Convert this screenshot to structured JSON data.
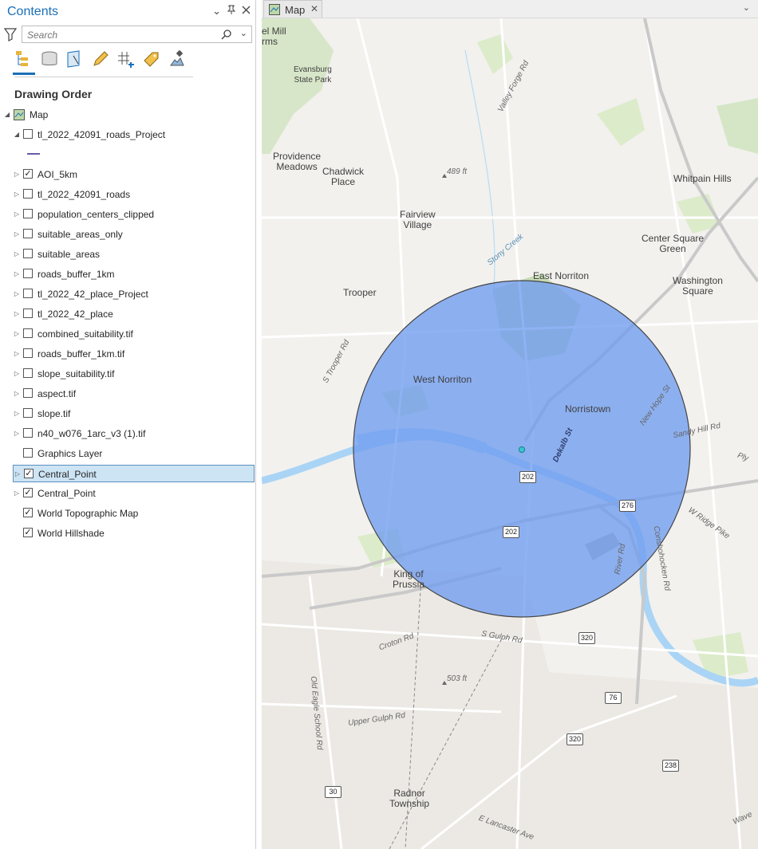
{
  "contents": {
    "title": "Contents",
    "search_placeholder": "Search",
    "section_title": "Drawing Order",
    "map_label": "Map",
    "layers": [
      {
        "name": "tl_2022_42091_roads_Project",
        "checked": false,
        "expanded": true
      },
      {
        "name": "AOI_5km",
        "checked": true,
        "expanded": false
      },
      {
        "name": "tl_2022_42091_roads",
        "checked": false,
        "expanded": false
      },
      {
        "name": "population_centers_clipped",
        "checked": false,
        "expanded": false
      },
      {
        "name": "suitable_areas_only",
        "checked": false,
        "expanded": false
      },
      {
        "name": "suitable_areas",
        "checked": false,
        "expanded": false
      },
      {
        "name": "roads_buffer_1km",
        "checked": false,
        "expanded": false
      },
      {
        "name": "tl_2022_42_place_Project",
        "checked": false,
        "expanded": false
      },
      {
        "name": "tl_2022_42_place",
        "checked": false,
        "expanded": false
      },
      {
        "name": "combined_suitability.tif",
        "checked": false,
        "expanded": false
      },
      {
        "name": "roads_buffer_1km.tif",
        "checked": false,
        "expanded": false
      },
      {
        "name": "slope_suitability.tif",
        "checked": false,
        "expanded": false
      },
      {
        "name": "aspect.tif",
        "checked": false,
        "expanded": false
      },
      {
        "name": "slope.tif",
        "checked": false,
        "expanded": false
      },
      {
        "name": "n40_w076_1arc_v3 (1).tif",
        "checked": false,
        "expanded": false
      },
      {
        "name": "Graphics Layer",
        "checked": false,
        "expanded": null
      },
      {
        "name": "Central_Point",
        "checked": true,
        "expanded": false,
        "selected": true
      },
      {
        "name": "Central_Point",
        "checked": true,
        "expanded": false
      },
      {
        "name": "World Topographic Map",
        "checked": true,
        "expanded": null
      },
      {
        "name": "World Hillshade",
        "checked": true,
        "expanded": null
      }
    ]
  },
  "map_tab": {
    "label": "Map"
  },
  "map": {
    "places": {
      "mill": "el Mill\nrms",
      "evansburg": "Evansburg\nState Park",
      "providence": "Providence\nMeadows",
      "chadwick": "Chadwick\nPlace",
      "whitpain": "Whitpain Hills",
      "fairview": "Fairview\nVillage",
      "center_square": "Center Square\nGreen",
      "east_norriton": "East Norriton",
      "washington": "Washington\nSquare",
      "trooper": "Trooper",
      "west_norriton": "West Norriton",
      "norristown": "Norristown",
      "king_prussia": "King of\nPrussia",
      "radnor": "Radnor\nTownship"
    },
    "roads": {
      "valley_forge": "Valley Forge Rd",
      "stony_creek": "Stony Creek",
      "s_trooper": "S Trooper Rd",
      "new_hope": "New Hope St",
      "sandy_hill": "Sandy Hill Rd",
      "ply": "Ply",
      "dekalb": "Dekalb St",
      "w_ridge": "W Ridge Pike",
      "conshohocken": "Conshohocken Rd",
      "river": "River Rd",
      "croton": "Croton Rd",
      "s_gulph": "S Gulph Rd",
      "old_eagle": "Old Eagle School Rd",
      "upper_gulph": "Upper Gulph Rd",
      "e_lancaster": "E Lancaster Ave",
      "wave": "Wave"
    },
    "elevations": {
      "e489": "489 ft",
      "e503": "503 ft"
    },
    "shields": {
      "s202a": "202",
      "s202b": "202",
      "s276": "276",
      "s320a": "320",
      "s320b": "320",
      "s76": "76",
      "s238": "238",
      "s30": "30"
    },
    "colors": {
      "aoi_fill": "#6f9cf0",
      "aoi_stroke": "#444444",
      "river": "#a9d4f5",
      "park": "#cfe3c1"
    }
  }
}
